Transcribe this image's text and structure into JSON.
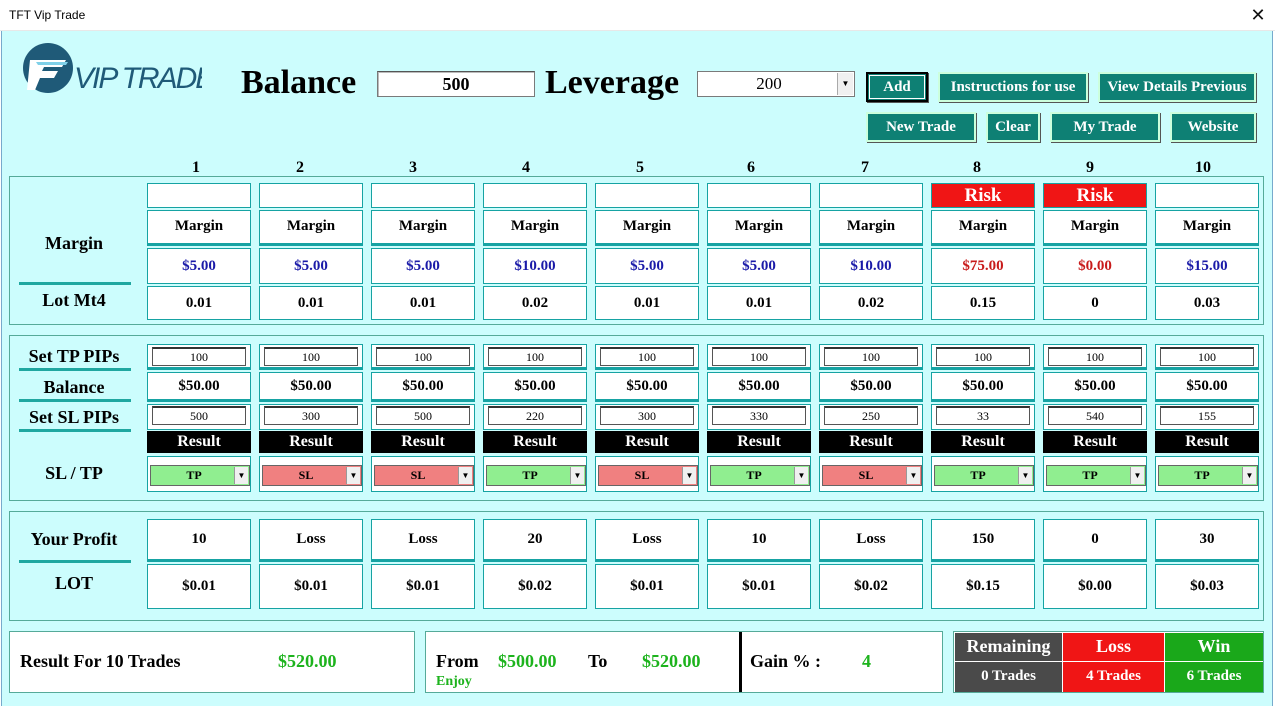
{
  "window": {
    "title": "TFT Vip Trade",
    "close_glyph": "✕"
  },
  "logo": {
    "text": "VIP TRADE"
  },
  "header": {
    "balance_label": "Balance",
    "balance_value": "500",
    "leverage_label": "Leverage",
    "leverage_value": "200"
  },
  "buttons": {
    "add": "Add",
    "instructions": "Instructions for use",
    "view_details": "View Details Previous",
    "new_trade": "New Trade",
    "clear": "Clear",
    "my_trade": "My Trade",
    "website": "Website"
  },
  "labels": {
    "margin": "Margin",
    "lot_mt4": "Lot Mt4",
    "set_tp": "Set TP PIPs",
    "balance": "Balance",
    "set_sl": "Set SL PIPs",
    "sl_tp": "SL / TP",
    "your_profit": "Your Profit",
    "lot": "LOT",
    "result": "Result",
    "risk": "Risk"
  },
  "columns": [
    {
      "num": "1",
      "risk": false,
      "margin_label": "Margin",
      "margin": "$5.00",
      "margin_color": "#1a1aa8",
      "lot": "0.01",
      "tp": "100",
      "balance": "$50.00",
      "sl": "500",
      "outcome": "TP",
      "profit": "10",
      "lot_value": "$0.01"
    },
    {
      "num": "2",
      "risk": false,
      "margin_label": "Margin",
      "margin": "$5.00",
      "margin_color": "#1a1aa8",
      "lot": "0.01",
      "tp": "100",
      "balance": "$50.00",
      "sl": "300",
      "outcome": "SL",
      "profit": "Loss",
      "lot_value": "$0.01"
    },
    {
      "num": "3",
      "risk": false,
      "margin_label": "Margin",
      "margin": "$5.00",
      "margin_color": "#1a1aa8",
      "lot": "0.01",
      "tp": "100",
      "balance": "$50.00",
      "sl": "500",
      "outcome": "SL",
      "profit": "Loss",
      "lot_value": "$0.01"
    },
    {
      "num": "4",
      "risk": false,
      "margin_label": "Margin",
      "margin": "$10.00",
      "margin_color": "#1a1aa8",
      "lot": "0.02",
      "tp": "100",
      "balance": "$50.00",
      "sl": "220",
      "outcome": "TP",
      "profit": "20",
      "lot_value": "$0.02"
    },
    {
      "num": "5",
      "risk": false,
      "margin_label": "Margin",
      "margin": "$5.00",
      "margin_color": "#1a1aa8",
      "lot": "0.01",
      "tp": "100",
      "balance": "$50.00",
      "sl": "300",
      "outcome": "SL",
      "profit": "Loss",
      "lot_value": "$0.01"
    },
    {
      "num": "6",
      "risk": false,
      "margin_label": "Margin",
      "margin": "$5.00",
      "margin_color": "#1a1aa8",
      "lot": "0.01",
      "tp": "100",
      "balance": "$50.00",
      "sl": "330",
      "outcome": "TP",
      "profit": "10",
      "lot_value": "$0.01"
    },
    {
      "num": "7",
      "risk": false,
      "margin_label": "Margin",
      "margin": "$10.00",
      "margin_color": "#1a1aa8",
      "lot": "0.02",
      "tp": "100",
      "balance": "$50.00",
      "sl": "250",
      "outcome": "SL",
      "profit": "Loss",
      "lot_value": "$0.02"
    },
    {
      "num": "8",
      "risk": true,
      "margin_label": "Margin",
      "margin": "$75.00",
      "margin_color": "#c81b1b",
      "lot": "0.15",
      "tp": "100",
      "balance": "$50.00",
      "sl": "33",
      "outcome": "TP",
      "profit": "150",
      "lot_value": "$0.15"
    },
    {
      "num": "9",
      "risk": true,
      "margin_label": "Margin",
      "margin": "$0.00",
      "margin_color": "#c81b1b",
      "lot": "0",
      "tp": "100",
      "balance": "$50.00",
      "sl": "540",
      "outcome": "TP",
      "profit": "0",
      "lot_value": "$0.00"
    },
    {
      "num": "10",
      "risk": false,
      "margin_label": "Margin",
      "margin": "$15.00",
      "margin_color": "#1a1aa8",
      "lot": "0.03",
      "tp": "100",
      "balance": "$50.00",
      "sl": "155",
      "outcome": "TP",
      "profit": "30",
      "lot_value": "$0.03"
    }
  ],
  "outcome_colors": {
    "TP": "#90ee90",
    "SL": "#f08080"
  },
  "footer": {
    "result_label": "Result For 10 Trades",
    "result_value": "$520.00",
    "from_label": "From",
    "from_value": "$500.00",
    "to_label": "To",
    "to_value": "$520.00",
    "enjoy": "Enjoy",
    "gain_label": "Gain % :",
    "gain_value": "4",
    "remaining_label": "Remaining",
    "remaining_value": "0 Trades",
    "loss_label": "Loss",
    "loss_value": "4 Trades",
    "win_label": "Win",
    "win_value": "6 Trades"
  }
}
